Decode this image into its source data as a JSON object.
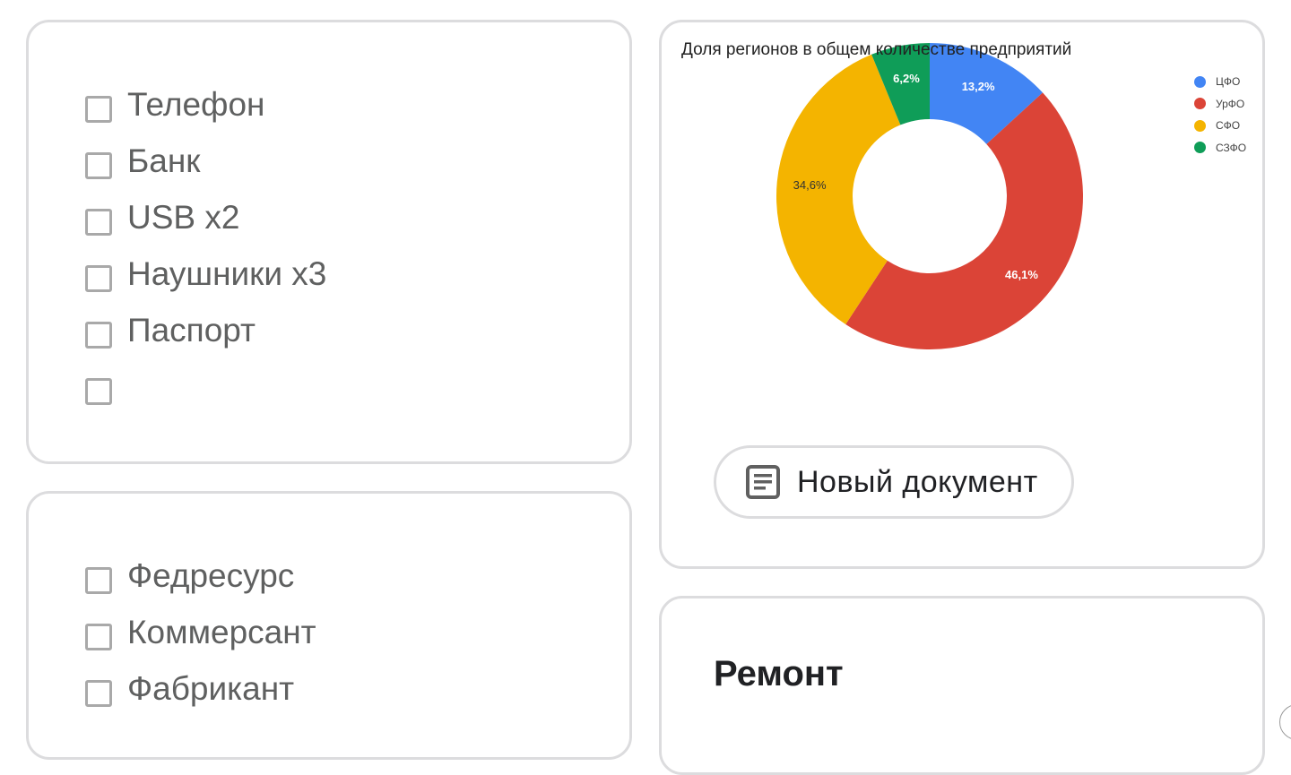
{
  "checklist_top": {
    "items": [
      {
        "label": "Телефон",
        "checked": false
      },
      {
        "label": "Банк",
        "checked": false
      },
      {
        "label": "USB x2",
        "checked": false
      },
      {
        "label": "Наушники x3",
        "checked": false
      },
      {
        "label": "Паспорт",
        "checked": false
      },
      {
        "label": "",
        "checked": false
      }
    ]
  },
  "checklist_bottom": {
    "items": [
      {
        "label": "Федресурс",
        "checked": false
      },
      {
        "label": "Коммерсант",
        "checked": false
      },
      {
        "label": "Фабрикант",
        "checked": false
      }
    ]
  },
  "chart_data": {
    "type": "pie",
    "variant": "donut",
    "title": "Доля регионов в общем количестве предприятий",
    "categories": [
      "ЦФО",
      "УрФО",
      "СФО",
      "СЗФО"
    ],
    "values": [
      13.2,
      46.1,
      34.6,
      6.2
    ],
    "labels": [
      "13,2%",
      "46,1%",
      "34,6%",
      "6,2%"
    ],
    "colors": [
      "#4285f4",
      "#db4437",
      "#f4b400",
      "#0f9d58"
    ],
    "label_colors": [
      "#ffffff",
      "#ffffff",
      "#333333",
      "#ffffff"
    ],
    "legend_position": "top-right",
    "start_angle": "12 o'clock",
    "direction": "clockwise"
  },
  "new_document_button": {
    "label": "Новый документ",
    "icon": "document-icon"
  },
  "repair_card": {
    "title": "Ремонт"
  }
}
